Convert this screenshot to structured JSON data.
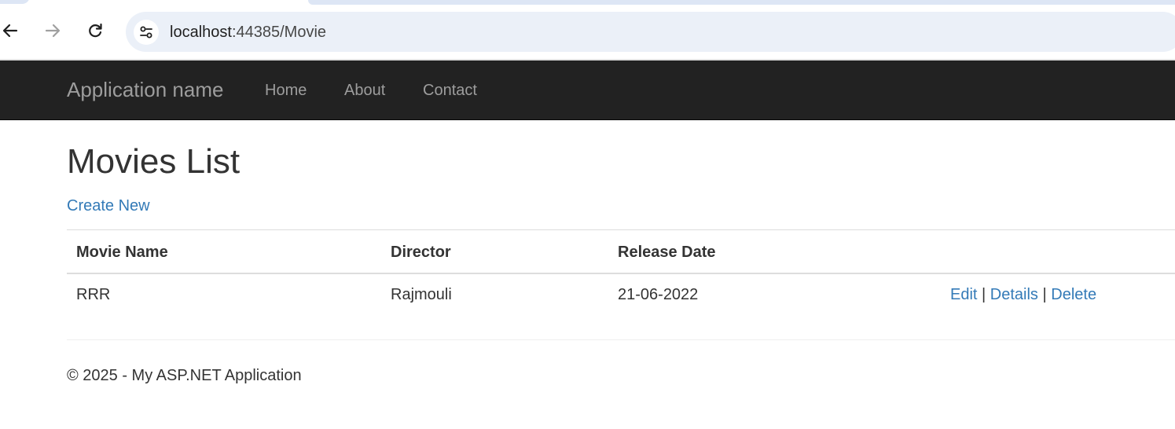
{
  "browser": {
    "url_host": "localhost",
    "url_rest": ":44385/Movie",
    "icons": {
      "back": "arrow-left-icon",
      "forward": "arrow-right-icon",
      "reload": "reload-icon",
      "site_info": "tune-icon"
    }
  },
  "navbar": {
    "brand": "Application name",
    "links": [
      "Home",
      "About",
      "Contact"
    ]
  },
  "page": {
    "title": "Movies List",
    "create_link": "Create New"
  },
  "table": {
    "headers": [
      "Movie Name",
      "Director",
      "Release Date",
      ""
    ],
    "rows": [
      {
        "movie_name": "RRR",
        "director": "Rajmouli",
        "release_date": "21-06-2022",
        "actions": [
          "Edit",
          "Details",
          "Delete"
        ],
        "separator": "|"
      }
    ]
  },
  "footer": {
    "text": "© 2025 - My ASP.NET Application"
  },
  "colors": {
    "navbar_bg": "#222222",
    "navbar_text": "#9d9d9d",
    "link": "#337ab7",
    "text": "#333333",
    "omnibox_bg": "#ebf0f8"
  }
}
